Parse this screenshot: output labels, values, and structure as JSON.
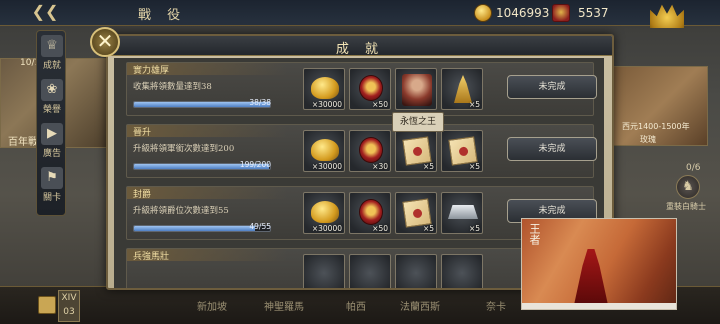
{
  "top_bar": {
    "screen_title": "戰 役",
    "gold": "1046993",
    "honor": "5537"
  },
  "left_rail": {
    "items": [
      {
        "label": "成就",
        "icon": "trophy-icon"
      },
      {
        "label": "榮譽",
        "icon": "laurel-icon"
      },
      {
        "label": "廣告",
        "icon": "video-icon"
      },
      {
        "label": "關卡",
        "icon": "flag-icon"
      }
    ]
  },
  "background": {
    "left_year": "10/12",
    "left_panel_label": "百年戰",
    "right_panel_text": "西元1400-1500年",
    "right_panel_sub": "玫瑰",
    "knight_count": "0/6",
    "knight_label": "重裝白騎士",
    "page_badge": "XIV",
    "page_num": "03",
    "bottom_tabs": [
      "新加坡",
      "神聖羅馬",
      "帕西",
      "法蘭西斯",
      "奈卡"
    ]
  },
  "dialog": {
    "title": "成 就",
    "tooltip": "永恆之王",
    "rows": [
      {
        "title": "實力雄厚",
        "desc": "收集將領數量達到38",
        "progress": 1.0,
        "progress_text": "38/38",
        "rewards": [
          {
            "icon": "gold-pile-icon",
            "qty": "×30000"
          },
          {
            "icon": "medal-icon",
            "qty": "×50"
          },
          {
            "icon": "portrait-icon",
            "qty": ""
          },
          {
            "icon": "statue-icon",
            "qty": "×5"
          }
        ],
        "status": "未完成"
      },
      {
        "title": "晉升",
        "desc": "升級將領軍銜次數達到200",
        "progress": 0.995,
        "progress_text": "199/200",
        "rewards": [
          {
            "icon": "gold-pile-icon",
            "qty": "×30000"
          },
          {
            "icon": "medal-icon",
            "qty": "×30"
          },
          {
            "icon": "scroll-icon",
            "qty": "×5"
          },
          {
            "icon": "scroll-icon",
            "qty": "×5"
          }
        ],
        "status": "未完成"
      },
      {
        "title": "封爵",
        "desc": "升級將領爵位次數達到55",
        "progress": 0.89,
        "progress_text": "49/55",
        "rewards": [
          {
            "icon": "gold-pile-icon",
            "qty": "×30000"
          },
          {
            "icon": "medal-icon",
            "qty": "×50"
          },
          {
            "icon": "scroll-icon",
            "qty": "×5"
          },
          {
            "icon": "ingot-icon",
            "qty": "×5"
          }
        ],
        "status": "未完成"
      },
      {
        "title": "兵強馬壯",
        "desc": "",
        "progress": 0,
        "progress_text": "",
        "rewards": [],
        "status": ""
      }
    ]
  },
  "video_overlay": {
    "logo": "王者"
  }
}
